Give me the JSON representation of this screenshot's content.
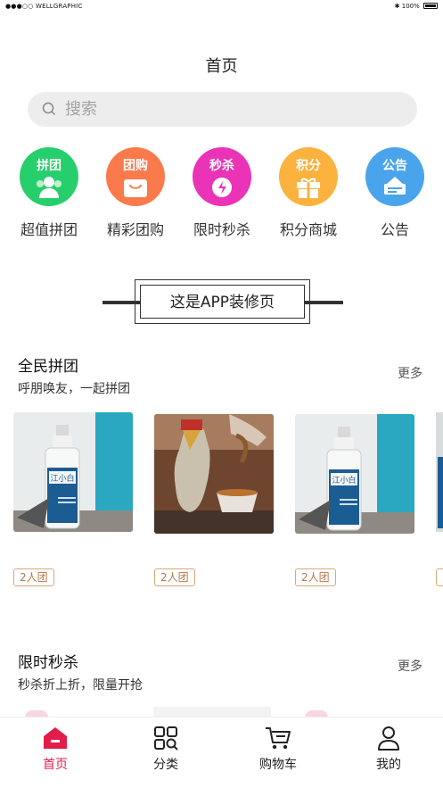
{
  "status": {
    "carrier": "●●●○○ WELLGRAPHIC",
    "battery": "100%"
  },
  "page": {
    "title": "首页"
  },
  "search": {
    "placeholder": "搜索"
  },
  "nav": [
    {
      "badge": "拼团",
      "label": "超值拼团",
      "color": "#27cf6c",
      "icon": "group-people-icon"
    },
    {
      "badge": "团购",
      "label": "精彩团购",
      "color": "#fb7a4b",
      "icon": "shopping-bag-icon"
    },
    {
      "badge": "秒杀",
      "label": "限时秒杀",
      "color": "#ea33b6",
      "icon": "alarm-clock-icon"
    },
    {
      "badge": "积分",
      "label": "积分商城",
      "color": "#fbb23f",
      "icon": "gift-icon"
    },
    {
      "badge": "公告",
      "label": "公告",
      "color": "#4aa4ec",
      "icon": "notice-board-icon"
    }
  ],
  "decoration": {
    "text": "这是APP装修页"
  },
  "group_section": {
    "title": "全民拼团",
    "subtitle": "呼朋唤友，一起拼团",
    "more": "更多",
    "products": [
      {
        "image": "liquor-bottle-jiangxiaobai",
        "tag": "2人团"
      },
      {
        "image": "pouring-liquor-jar",
        "tag": "2人团"
      },
      {
        "image": "liquor-bottle-jiangxiaobai",
        "tag": "2人团"
      }
    ]
  },
  "flash_section": {
    "title": "限时秒杀",
    "subtitle": "秒杀折上折，限量开抢",
    "more": "更多"
  },
  "bottom_nav": [
    {
      "label": "首页",
      "icon": "home-icon",
      "active": true
    },
    {
      "label": "分类",
      "icon": "category-icon",
      "active": false
    },
    {
      "label": "购物车",
      "icon": "cart-icon",
      "active": false
    },
    {
      "label": "我的",
      "icon": "user-icon",
      "active": false
    }
  ],
  "colors": {
    "accent": "#e21d49",
    "tag_border": "#d9a878"
  }
}
